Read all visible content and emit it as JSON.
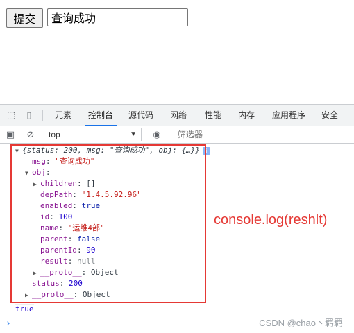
{
  "page": {
    "submit_label": "提交",
    "input_value": "查询成功"
  },
  "devtools": {
    "tabs": [
      "元素",
      "控制台",
      "源代码",
      "网络",
      "性能",
      "内存",
      "应用程序",
      "安全"
    ],
    "active_tab": "控制台",
    "context": "top",
    "filter_placeholder": "筛选器"
  },
  "console": {
    "summary_key_status": "status",
    "summary_val_status": "200",
    "summary_key_msg": "msg",
    "summary_val_msg": "\"查询成功\"",
    "summary_key_obj": "obj",
    "summary_val_obj": "{…}",
    "msg_key": "msg",
    "msg_val": "\"查询成功\"",
    "obj_key": "obj",
    "children_key": "children",
    "children_val": "[]",
    "depPath_key": "depPath",
    "depPath_val": "\"1.4.5.92.96\"",
    "enabled_key": "enabled",
    "enabled_val": "true",
    "id_key": "id",
    "id_val": "100",
    "name_key": "name",
    "name_val": "\"运维4部\"",
    "parent_key": "parent",
    "parent_val": "false",
    "parentId_key": "parentId",
    "parentId_val": "90",
    "result_key": "result",
    "result_val": "null",
    "proto_key": "__proto__",
    "proto_val": "Object",
    "status_key": "status",
    "status_val": "200",
    "outer_proto_key": "__proto__",
    "outer_proto_val": "Object",
    "true_output": "true"
  },
  "annotation": "console.log(reshlt)",
  "watermark": "CSDN @chao丶羁羁",
  "colors": {
    "annotation_red": "#e53935",
    "active_tab_underline": "#1a73e8"
  }
}
